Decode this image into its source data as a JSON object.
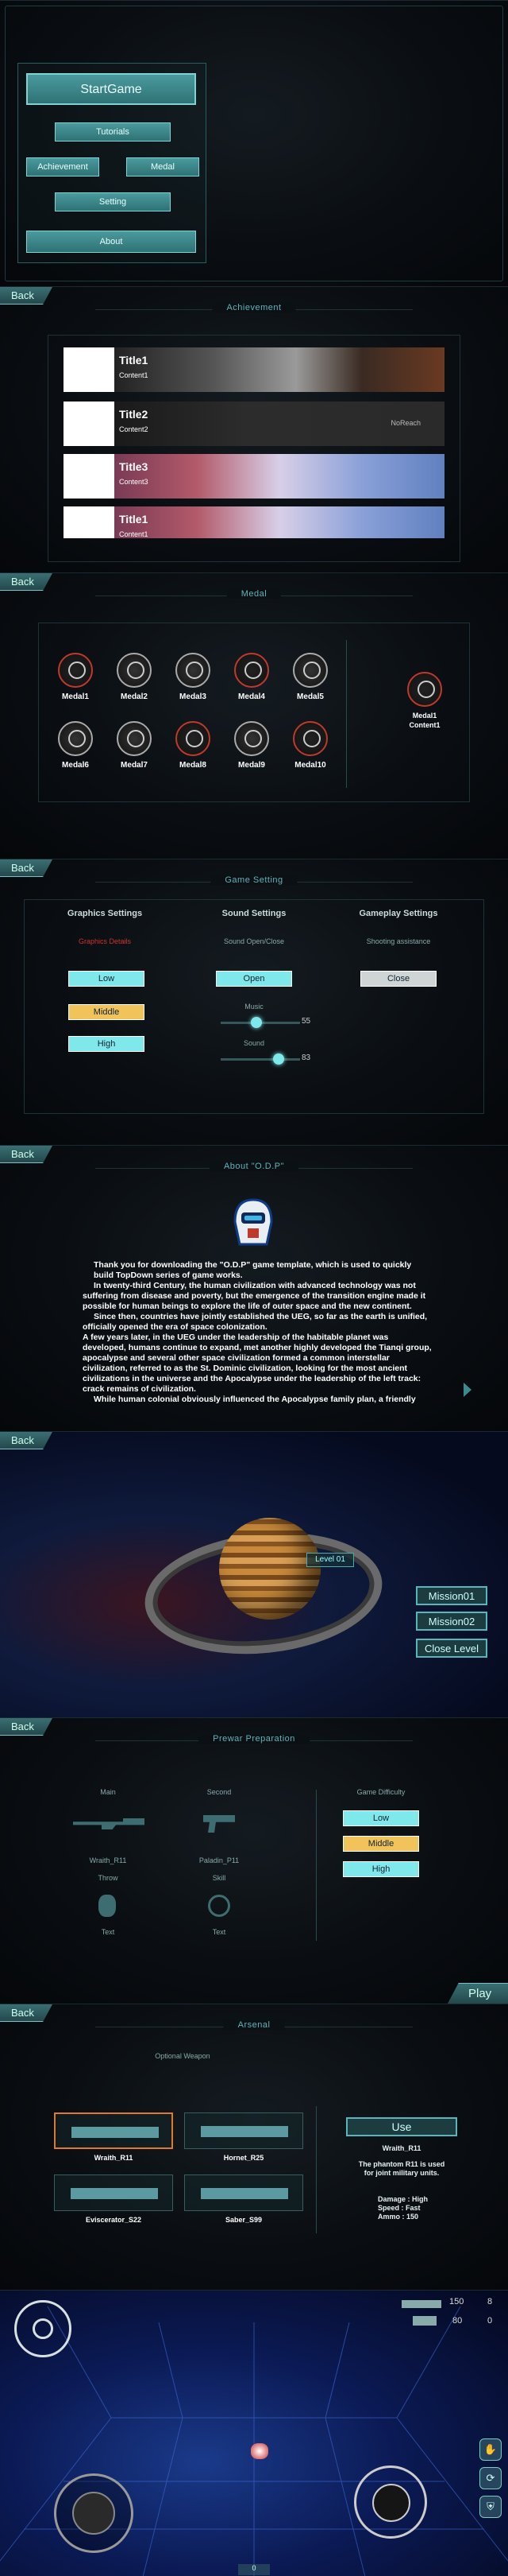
{
  "main_menu": {
    "start": "StartGame",
    "tutorials": "Tutorials",
    "achievement": "Achievement",
    "medal": "Medal",
    "setting": "Setting",
    "about": "About"
  },
  "back_label": "Back",
  "achievement": {
    "header": "Achievement",
    "items": [
      {
        "title": "Title1",
        "content": "Content1",
        "right": "..."
      },
      {
        "title": "Title2",
        "content": "Content2",
        "right": "NoReach"
      },
      {
        "title": "Title3",
        "content": "Content3",
        "right": "..."
      },
      {
        "title": "Title1",
        "content": "Content1",
        "right": "..."
      }
    ]
  },
  "medal": {
    "header": "Medal",
    "items": [
      "Medal1",
      "Medal2",
      "Medal3",
      "Medal4",
      "Medal5",
      "Medal6",
      "Medal7",
      "Medal8",
      "Medal9",
      "Medal10"
    ],
    "detail_name": "Medal1",
    "detail_content": "Content1"
  },
  "settings": {
    "header": "Game Setting",
    "graphics_title": "Graphics Settings",
    "graphics_sub": "Graphics Details",
    "graphics_options": [
      "Low",
      "Middle",
      "High"
    ],
    "sound_title": "Sound Settings",
    "sound_sub": "Sound Open/Close",
    "sound_toggle": "Open",
    "music_label": "Music",
    "music_value": "55",
    "music_level": 0.55,
    "sound_label": "Sound",
    "sound_value": "83",
    "sound_level": 0.83,
    "gameplay_title": "Gameplay Settings",
    "gameplay_sub": "Shooting assistance",
    "gameplay_toggle": "Close"
  },
  "about": {
    "header": "About \"O.D.P\"",
    "paragraphs": [
      "Thank you for downloading the \"O.D.P\" game template, which is used to quickly build TopDown series of game works.",
      "In twenty-third Century, the human civilization with advanced technology was not suffering from disease and poverty, but the emergence of the transition engine made it possible for human beings to explore the life of outer space and the new continent.",
      "Since then, countries have jointly established the UEG, so far as the earth is unified, officially opened the era of space colonization.",
      "A few years later, in the UEG under the leadership of the habitable planet was developed, humans continue to expand, met another highly developed the Tianqi group, apocalypse and several other space civilization formed a common interstellar civilization, referred to as the St. Dominic civilization, looking for the most ancient civilizations in the universe and the Apocalypse under the leadership of the left track: crack remains of civilization.",
      "While human colonial obviously influenced the Apocalypse family plan, a friendly"
    ]
  },
  "level": {
    "planet_label": "Level 01",
    "missions": [
      "Mission01",
      "Mission02",
      "Close Level"
    ]
  },
  "prep": {
    "header": "Prewar Preparation",
    "main_label": "Main",
    "main_weapon": "Wraith_R11",
    "second_label": "Second",
    "second_weapon": "Paladin_P11",
    "throw_label": "Throw",
    "throw_value": "Text",
    "skill_label": "Skill",
    "skill_value": "Text",
    "difficulty_title": "Game Difficulty",
    "difficulty_options": [
      "Low",
      "Middle",
      "High"
    ],
    "play": "Play"
  },
  "arsenal": {
    "header": "Arsenal",
    "sub": "Optional Weapon",
    "weapons": [
      "Wraith_R11",
      "Hornet_R25",
      "Eviscerator_S22",
      "Saber_S99"
    ],
    "use": "Use",
    "detail_name": "Wraith_R11",
    "detail_desc": "The phantom R11 is used for joint military units.",
    "damage": "Damage : High",
    "speed": "Speed : Fast",
    "ammo": "Ammo : 150"
  },
  "hud": {
    "ammo1": "150",
    "ammo1_side": "8",
    "ammo2": "80",
    "ammo2_side": "0",
    "bottom_tag": "0"
  },
  "colors": {
    "accent": "#4fa8ab",
    "highlight": "#7fe8ea",
    "selected": "#f0c45a"
  }
}
